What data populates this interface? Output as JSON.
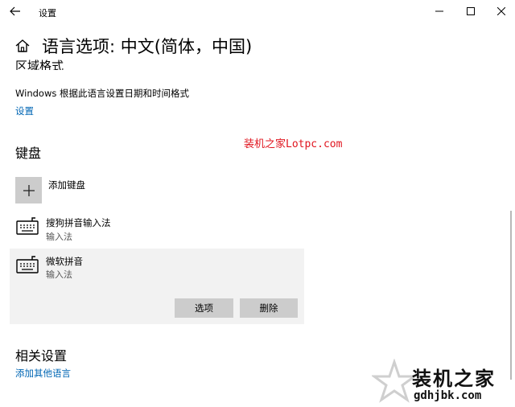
{
  "window": {
    "title": "设置"
  },
  "page": {
    "title": "语言选项: 中文(简体，中国)"
  },
  "region": {
    "heading": "区域格式",
    "description": "Windows 根据此语言设置日期和时间格式",
    "settings_link": "设置"
  },
  "watermark": {
    "top_text": "装机之家Lotpc.com",
    "bottom_big": "装机之家",
    "bottom_small": "gdhjbk.com"
  },
  "keyboard": {
    "heading": "键盘",
    "add_label": "添加键盘",
    "items": [
      {
        "name": "搜狗拼音输入法",
        "type": "输入法"
      },
      {
        "name": "微软拼音",
        "type": "输入法"
      }
    ],
    "options_label": "选项",
    "delete_label": "删除"
  },
  "related": {
    "heading": "相关设置",
    "add_language_link": "添加其他语言"
  },
  "colors": {
    "link": "#0066b4",
    "watermark": "#e0141e",
    "button": "#cccccc",
    "selected_panel": "#f2f2f2"
  }
}
